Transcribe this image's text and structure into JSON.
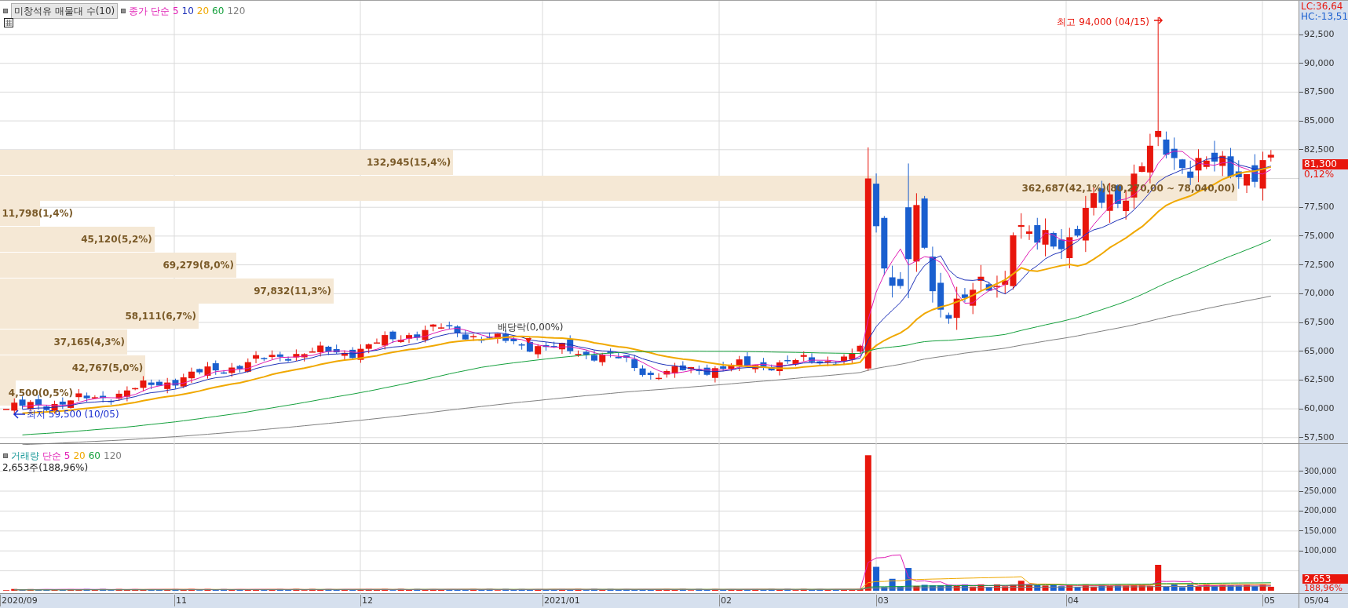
{
  "legend": {
    "title": "미창석유 매물대 수(10)",
    "items": [
      {
        "label": "종가 단순 5",
        "color": "#e01cb4"
      },
      {
        "label": "10",
        "color": "#1c2fb8"
      },
      {
        "label": "20",
        "color": "#f0a800"
      },
      {
        "label": "60",
        "color": "#14a03c"
      },
      {
        "label": "120",
        "color": "#808080"
      }
    ]
  },
  "volume_profile": [
    {
      "label": "132,945(15,4%)",
      "level": 0.349
    },
    {
      "label": "362,687(42,1%)(80,270,00 ~ 78,040,00)",
      "level": 0.953
    },
    {
      "label": "11,798(1,4%)",
      "level": 0.031
    },
    {
      "label": "45,120(5,2%)",
      "level": 0.119
    },
    {
      "label": "69,279(8,0%)",
      "level": 0.182
    },
    {
      "label": "97,832(11,3%)",
      "level": 0.257
    },
    {
      "label": "58,111(6,7%)",
      "level": 0.153
    },
    {
      "label": "37,165(4,3%)",
      "level": 0.098
    },
    {
      "label": "42,767(5,0%)",
      "level": 0.112
    },
    {
      "label": "4,500(0,5%)",
      "level": 0.012
    }
  ],
  "annotations": {
    "high": "최고 94,000 (04/15)",
    "low": "최저 59,500 (10/05)",
    "dividend": "배당락(0,00%)"
  },
  "price_axis": {
    "lc": "LC:36,64",
    "hc": "HC:-13,51",
    "ticks": [
      "92,500",
      "90,000",
      "87,500",
      "85,000",
      "82,500",
      "77,500",
      "75,000",
      "72,500",
      "70,000",
      "67,500",
      "65,000",
      "62,500",
      "60,000",
      "57,500"
    ],
    "current_price": "81,300",
    "current_change": "0,12%"
  },
  "volume_legend": {
    "items": [
      {
        "label": "거래량",
        "color": "#1c9a9a"
      },
      {
        "label": "단순 5",
        "color": "#e01cb4"
      },
      {
        "label": "20",
        "color": "#f0a800"
      },
      {
        "label": "60",
        "color": "#14a03c"
      },
      {
        "label": "120",
        "color": "#808080"
      }
    ],
    "reading": "2,653주(188,96%)"
  },
  "volume_axis": {
    "ticks": [
      "300,000",
      "250,000",
      "200,000",
      "150,000",
      "100,000"
    ],
    "current_volume": "2,653",
    "current_ratio": "188,96%"
  },
  "date_axis": {
    "labels": [
      "2020/09",
      "11",
      "12",
      "2021/01",
      "02",
      "03",
      "04",
      "05"
    ],
    "current": "05/04"
  }
}
